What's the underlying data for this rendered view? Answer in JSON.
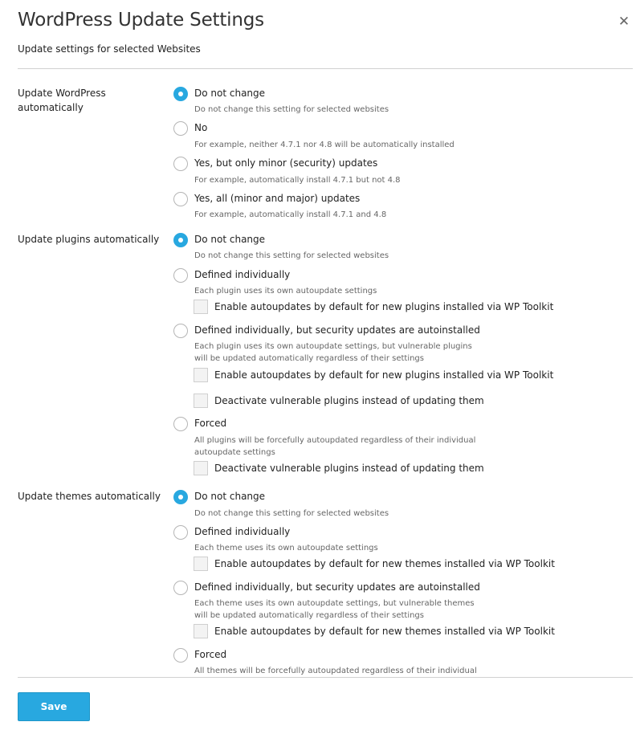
{
  "dialog": {
    "title": "WordPress Update Settings",
    "close_glyph": "✕",
    "subtitle": "Update settings for selected Websites",
    "save_label": "Save"
  },
  "wordpress": {
    "label": "Update WordPress automatically",
    "options": [
      {
        "label": "Do not change",
        "hint": "Do not change this setting for selected websites",
        "checked": true
      },
      {
        "label": "No",
        "hint": "For example, neither 4.7.1 nor 4.8 will be automatically installed",
        "checked": false
      },
      {
        "label": "Yes, but only minor (security) updates",
        "hint": "For example, automatically install 4.7.1 but not 4.8",
        "checked": false
      },
      {
        "label": "Yes, all (minor and major) updates",
        "hint": "For example, automatically install 4.7.1 and 4.8",
        "checked": false
      }
    ]
  },
  "plugins": {
    "label": "Update plugins automatically",
    "options": [
      {
        "label": "Do not change",
        "hint": "Do not change this setting for selected websites",
        "checked": true
      },
      {
        "label": "Defined individually",
        "hint": "Each plugin uses its own autoupdate settings",
        "checked": false
      },
      {
        "label": "Defined individually, but security updates are autoinstalled",
        "hint_line1": "Each plugin uses its own autoupdate settings, but vulnerable plugins",
        "hint_line2": "will be updated automatically regardless of their settings",
        "checked": false
      },
      {
        "label": "Forced",
        "hint_line1": "All plugins will be forcefully autoupdated regardless of their individual",
        "hint_line2": "autoupdate settings",
        "checked": false
      }
    ],
    "checkboxes": {
      "enable_new_individual": "Enable autoupdates by default for new plugins installed via WP Toolkit",
      "enable_new_security": "Enable autoupdates by default for new plugins installed via WP Toolkit",
      "deactivate_security": "Deactivate vulnerable plugins instead of updating them",
      "deactivate_forced": "Deactivate vulnerable plugins instead of updating them"
    }
  },
  "themes": {
    "label": "Update themes automatically",
    "options": [
      {
        "label": "Do not change",
        "hint": "Do not change this setting for selected websites",
        "checked": true
      },
      {
        "label": "Defined individually",
        "hint": "Each theme uses its own autoupdate settings",
        "checked": false
      },
      {
        "label": "Defined individually, but security updates are autoinstalled",
        "hint_line1": "Each theme uses its own autoupdate settings, but vulnerable themes",
        "hint_line2": "will be updated automatically regardless of their settings",
        "checked": false
      },
      {
        "label": "Forced",
        "hint": "All themes will be forcefully autoupdated regardless of their individual",
        "checked": false
      }
    ],
    "checkboxes": {
      "enable_new_individual": "Enable autoupdates by default for new themes installed via WP Toolkit",
      "enable_new_security": "Enable autoupdates by default for new themes installed via WP Toolkit"
    }
  },
  "colors": {
    "accent": "#28a8e0"
  }
}
